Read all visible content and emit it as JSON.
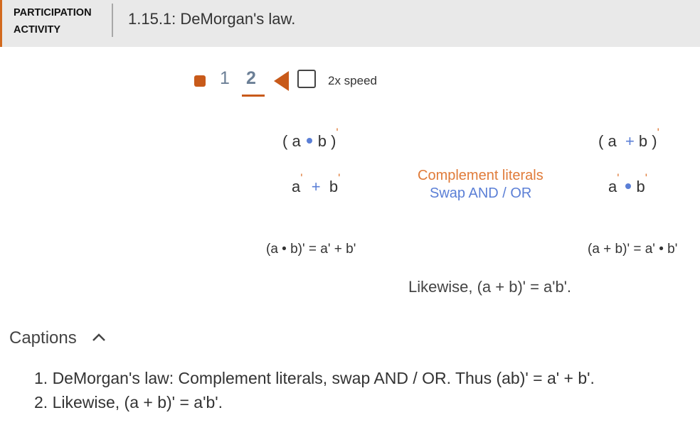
{
  "header": {
    "label": "Participation Activity",
    "title": "1.15.1: DeMorgan's law."
  },
  "controls": {
    "step1": "1",
    "step2": "2",
    "speed_label": "2x speed"
  },
  "animation": {
    "expr_left_a": "a",
    "expr_left_b": "b",
    "expr_left_open": "(",
    "expr_left_close": ")",
    "prime": "'",
    "plus": "+",
    "left_expand_a": "a",
    "left_expand_b": "b",
    "right_a": "a",
    "right_b": "b",
    "note_complement": "Complement literals",
    "note_swap": "Swap AND / OR",
    "result_left": "(a • b)' = a' + b'",
    "result_right": "(a + b)' = a' • b'",
    "likewise": "Likewise, (a + b)' = a'b'."
  },
  "captions": {
    "label": "Captions",
    "items": [
      "1. DeMorgan's law: Complement literals, swap AND / OR. Thus (ab)' = a' + b'.",
      "2. Likewise, (a + b)' = a'b'."
    ]
  },
  "colors": {
    "accent": "#c85a1a",
    "blue": "#5b7fd6",
    "orange": "#e07b39"
  }
}
